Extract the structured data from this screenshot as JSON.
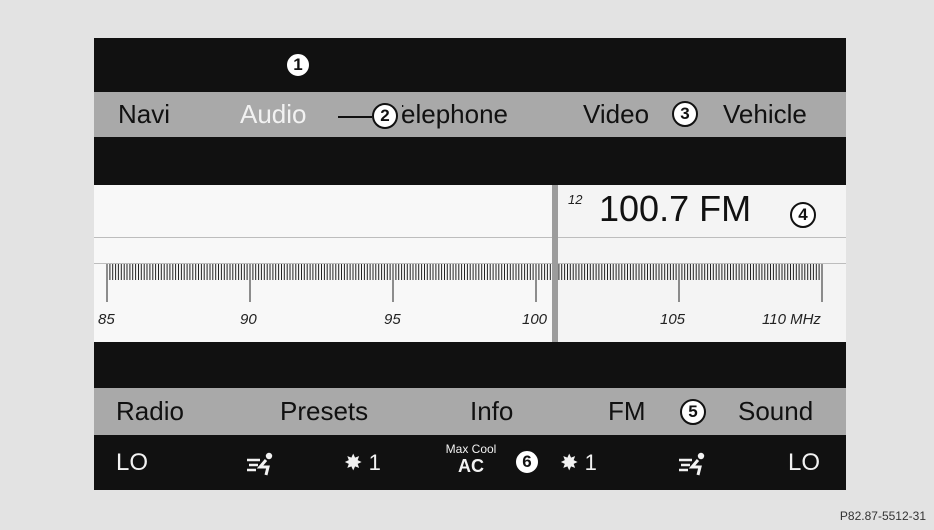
{
  "main_menu": [
    "Navi",
    "Audio",
    "Telephone",
    "Video",
    "Vehicle"
  ],
  "tuner": {
    "preset_number": "12",
    "frequency": "100.7 FM",
    "scale_labels": [
      "85",
      "90",
      "95",
      "100",
      "105",
      "110 MHz"
    ]
  },
  "sub_menu": [
    "Radio",
    "Presets",
    "Info",
    "FM",
    "Sound"
  ],
  "climate": {
    "left_temp": "LO",
    "left_fan": "1",
    "max_cool": "Max Cool",
    "ac": "AC",
    "right_fan": "1",
    "right_temp": "LO",
    "air_distribution_icon": "air-distribution-icon",
    "fan_icon": "fan-icon"
  },
  "callouts": [
    "1",
    "2",
    "3",
    "4",
    "5",
    "6"
  ],
  "figure_ref": "P82.87-5512-31",
  "colors": {
    "screen_bg": "#111111",
    "menu_bg": "#a9a9a9",
    "tuner_bg": "#f6f6f6",
    "text_light": "#f2f2f2"
  }
}
